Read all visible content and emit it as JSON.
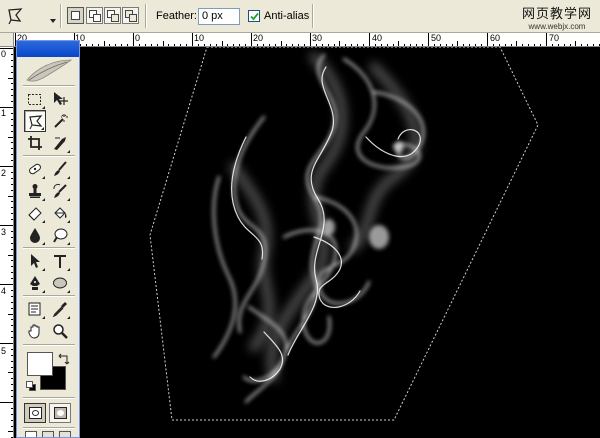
{
  "options_bar": {
    "tool_preset_icon": "polygonal-lasso-icon",
    "selection_modes": [
      "new-selection-icon",
      "add-to-selection-icon",
      "subtract-from-selection-icon",
      "intersect-selection-icon"
    ],
    "feather_label": "Feather:",
    "feather_value": "0 px",
    "anti_alias_label": "Anti-alias",
    "anti_alias_checked": true
  },
  "watermark": {
    "title": "网页教学网",
    "url": "www.webjx.com"
  },
  "ruler_top": {
    "labels": [
      "20",
      "10",
      "0",
      "10",
      "20",
      "30",
      "40",
      "50",
      "60",
      "70"
    ]
  },
  "ruler_left": {
    "labels": [
      "0",
      "1",
      "2",
      "3",
      "4",
      "5"
    ]
  },
  "toolbox": {
    "tools": [
      "rectangular-marquee-icon",
      "move-icon",
      "polygonal-lasso-icon",
      "magic-wand-icon",
      "crop-icon",
      "slice-icon",
      "healing-brush-icon",
      "brush-icon",
      "clone-stamp-icon",
      "history-brush-icon",
      "eraser-icon",
      "paint-bucket-icon",
      "blur-icon",
      "dodge-icon",
      "path-selection-icon",
      "type-icon",
      "pen-icon",
      "ellipse-shape-icon",
      "notes-icon",
      "eyedropper-icon",
      "hand-icon",
      "zoom-icon"
    ],
    "foreground_color": "#ffffff",
    "background_color": "#000000"
  },
  "colors": {
    "canvas": "#000000",
    "selection_marquee": "#cfcfcf",
    "toolbox_title": "#0a46c8"
  }
}
